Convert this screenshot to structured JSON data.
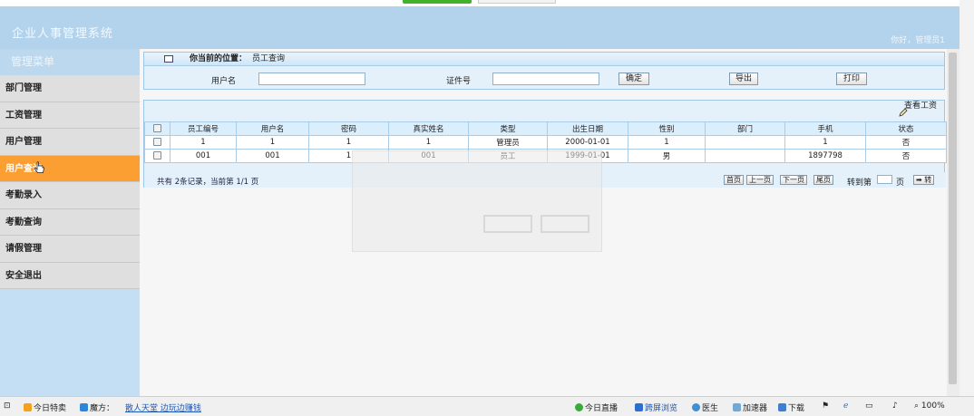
{
  "app": {
    "title": "企业人事管理系统",
    "welcome": "你好，管理员1"
  },
  "sidebar": {
    "header": "管理菜单",
    "items": [
      {
        "label": "部门管理"
      },
      {
        "label": "工资管理"
      },
      {
        "label": "用户管理"
      },
      {
        "label": "用户查询",
        "active": true
      },
      {
        "label": "考勤录入"
      },
      {
        "label": "考勤查询"
      },
      {
        "label": "请假管理"
      },
      {
        "label": "安全退出"
      }
    ]
  },
  "breadcrumb": {
    "label": "你当前的位置：",
    "value": "员工查询"
  },
  "search": {
    "username_label": "用户名",
    "username_value": "",
    "id_label": "证件号",
    "id_value": "",
    "confirm_label": "确定",
    "export_label": "导出",
    "print_label": "打印"
  },
  "list": {
    "view_salary_label": "查看工资",
    "columns": [
      "员工编号",
      "用户名",
      "密码",
      "真实姓名",
      "类型",
      "出生日期",
      "性别",
      "部门",
      "手机",
      "状态"
    ],
    "rows": [
      [
        "1",
        "1",
        "1",
        "1",
        "管理员",
        "2000-01-01",
        "1",
        "",
        "1",
        "否"
      ],
      [
        "001",
        "001",
        "1",
        "001",
        "员工",
        "1999-01-01",
        "男",
        "",
        "1897798",
        "否"
      ]
    ]
  },
  "pager": {
    "summary": "共有 2条记录，当前第 1/1 页",
    "first": "首页",
    "prev": "上一页",
    "next": "下一页",
    "last": "尾页",
    "goto_prefix": "转到第",
    "goto_suffix": "页",
    "go": "➡ 转"
  },
  "statusbar": {
    "item1": "今日特卖",
    "item2": "魔方：",
    "item3": "散人天堂 边玩边赚钱",
    "item4": "今日直播",
    "item5": "跨屏浏览",
    "item6": "医生",
    "item7": "加速器",
    "item8": "下载",
    "zoom": "100%"
  }
}
